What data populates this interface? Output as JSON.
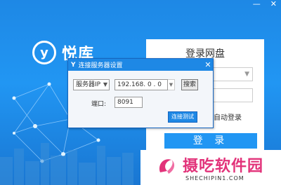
{
  "window_controls": {
    "minimize": "—",
    "close": "✕"
  },
  "brand": {
    "logo_letter": "y",
    "name": "悦库"
  },
  "login": {
    "title": "登录网盘",
    "auto_login_label": "自动登录",
    "login_button": "登 录"
  },
  "dialog": {
    "title": "连接服务器设置",
    "icon_letter": "Y",
    "protocol_value": "服务器IP",
    "ip_value": "192.168. 0 . 0",
    "search_button": "搜索",
    "port_label": "端口:",
    "port_value": "8091",
    "test_button": "连接测试"
  },
  "watermark": {
    "text": "摄吃软件园",
    "url": "SHECHIPIN1.COM"
  },
  "colors": {
    "accent": "#1e88e5",
    "watermark": "#e2337a"
  }
}
